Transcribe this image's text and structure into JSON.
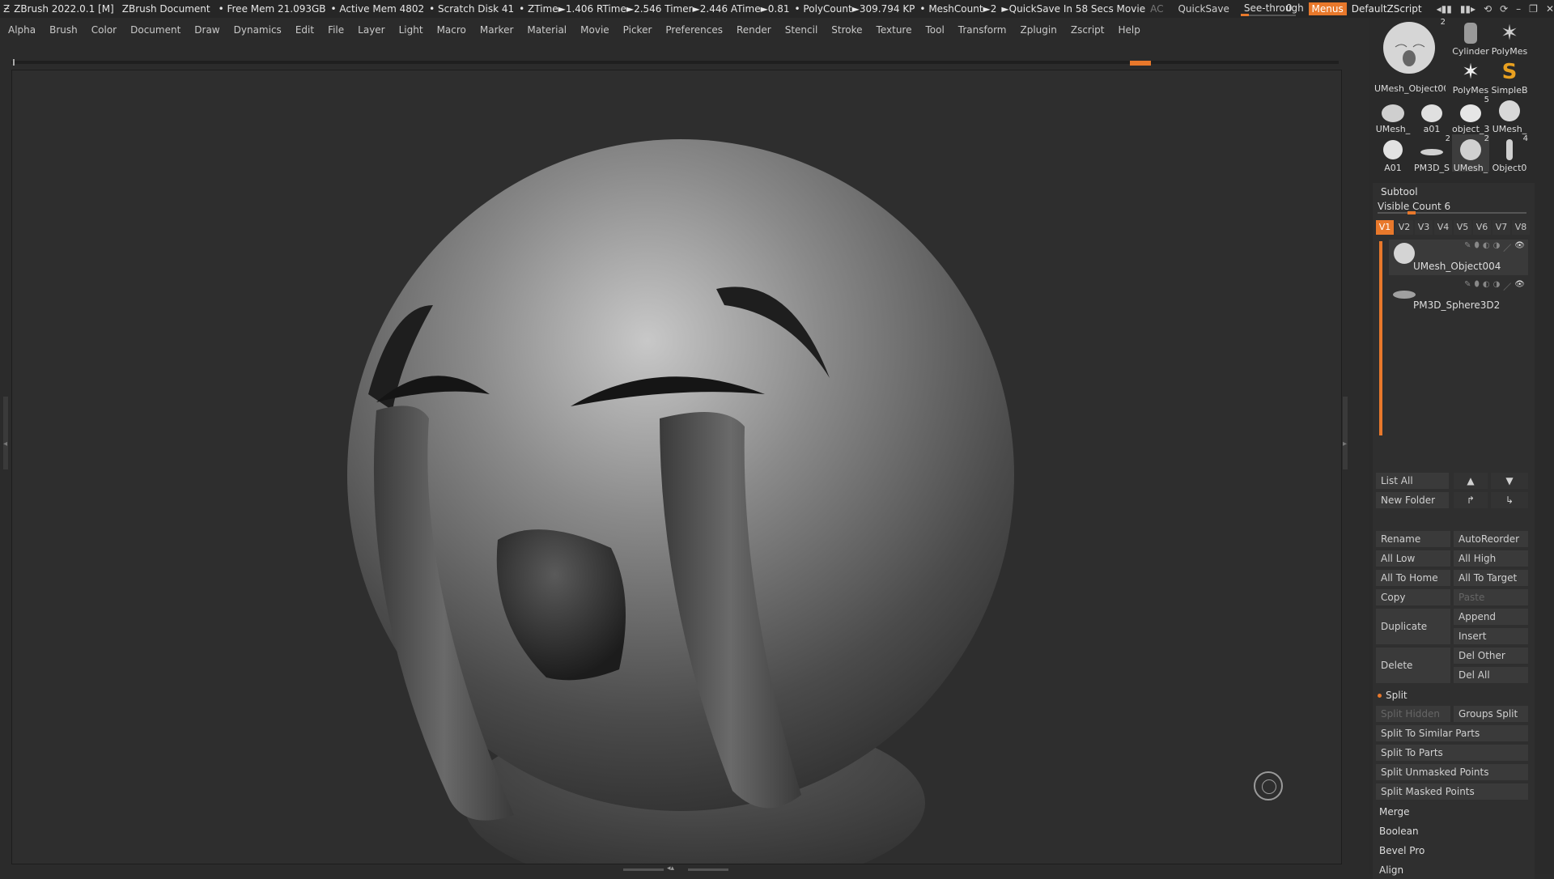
{
  "titlebar": {
    "app": "ZBrush 2022.0.1 [M]",
    "document": "ZBrush Document",
    "stats": [
      "• Free Mem 21.093GB",
      "• Active Mem 4802",
      "• Scratch Disk 41",
      "• ZTime►1.406 RTime►2.546 Timer►2.446 ATime►0.81",
      "• PolyCount►309.794 KP",
      "• MeshCount►2",
      "►QuickSave In 58 Secs Movie"
    ],
    "ac": "AC",
    "quicksave": "QuickSave",
    "see_through_label": "See-through",
    "see_through_value": "0",
    "menus": "Menus",
    "script": "DefaultZScript"
  },
  "menubar": [
    "Alpha",
    "Brush",
    "Color",
    "Document",
    "Draw",
    "Dynamics",
    "Edit",
    "File",
    "Layer",
    "Light",
    "Macro",
    "Marker",
    "Material",
    "Movie",
    "Picker",
    "Preferences",
    "Render",
    "Stencil",
    "Stroke",
    "Texture",
    "Tool",
    "Transform",
    "Zplugin",
    "Zscript",
    "Help"
  ],
  "tools": [
    {
      "label": "UMesh_Object00",
      "count": "2"
    },
    {
      "label": "Cylinder",
      "count": ""
    },
    {
      "label": "PolyMes",
      "count": ""
    },
    {
      "label": "PolyMes",
      "count": ""
    },
    {
      "label": "SimpleB",
      "count": ""
    },
    {
      "label": "UMesh_",
      "count": ""
    },
    {
      "label": "a01",
      "count": ""
    },
    {
      "label": "object_3",
      "count": "5"
    },
    {
      "label": "UMesh_",
      "count": ""
    },
    {
      "label": "A01",
      "count": ""
    },
    {
      "label": "PM3D_S",
      "count": "2"
    },
    {
      "label": "UMesh_",
      "count": "2"
    },
    {
      "label": "Object0",
      "count": "4"
    }
  ],
  "subtool": {
    "title": "Subtool",
    "visible_count_label": "Visible Count",
    "visible_count_value": "6",
    "visible_fraction": 0.2,
    "tabs": [
      "V1",
      "V2",
      "V3",
      "V4",
      "V5",
      "V6",
      "V7",
      "V8"
    ],
    "items": [
      "UMesh_Object004",
      "PM3D_Sphere3D2"
    ],
    "list_all": "List All",
    "new_folder": "New Folder",
    "rename": "Rename",
    "autoreorder": "AutoReorder",
    "all_low": "All Low",
    "all_high": "All High",
    "all_to_home": "All To Home",
    "all_to_target": "All To Target",
    "copy": "Copy",
    "paste": "Paste",
    "duplicate": "Duplicate",
    "append": "Append",
    "insert": "Insert",
    "delete": "Delete",
    "del_other": "Del Other",
    "del_all": "Del All",
    "split": "Split",
    "split_hidden": "Split Hidden",
    "groups_split": "Groups Split",
    "split_similar": "Split To Similar Parts",
    "split_parts": "Split To Parts",
    "split_unmasked": "Split Unmasked Points",
    "split_masked": "Split Masked Points",
    "merge": "Merge",
    "boolean": "Boolean",
    "bevel_pro": "Bevel Pro",
    "align": "Align"
  },
  "accent": "#e8782b"
}
